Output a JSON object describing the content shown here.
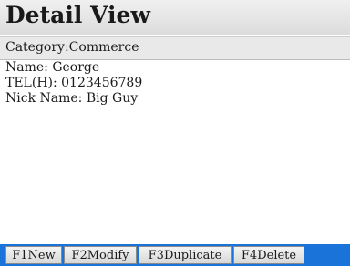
{
  "header": {
    "title": "Detail View"
  },
  "category": {
    "text": "Category:Commerce"
  },
  "detail": {
    "name": "Name: George",
    "tel": "TEL(H): 0123456789",
    "nick": "Nick Name: Big Guy"
  },
  "softkeys": {
    "f1": "F1New",
    "f2": "F2Modify",
    "f3": "F3Duplicate",
    "f4": "F4Delete"
  },
  "colors": {
    "softkey_bar": "#1a73d9"
  }
}
